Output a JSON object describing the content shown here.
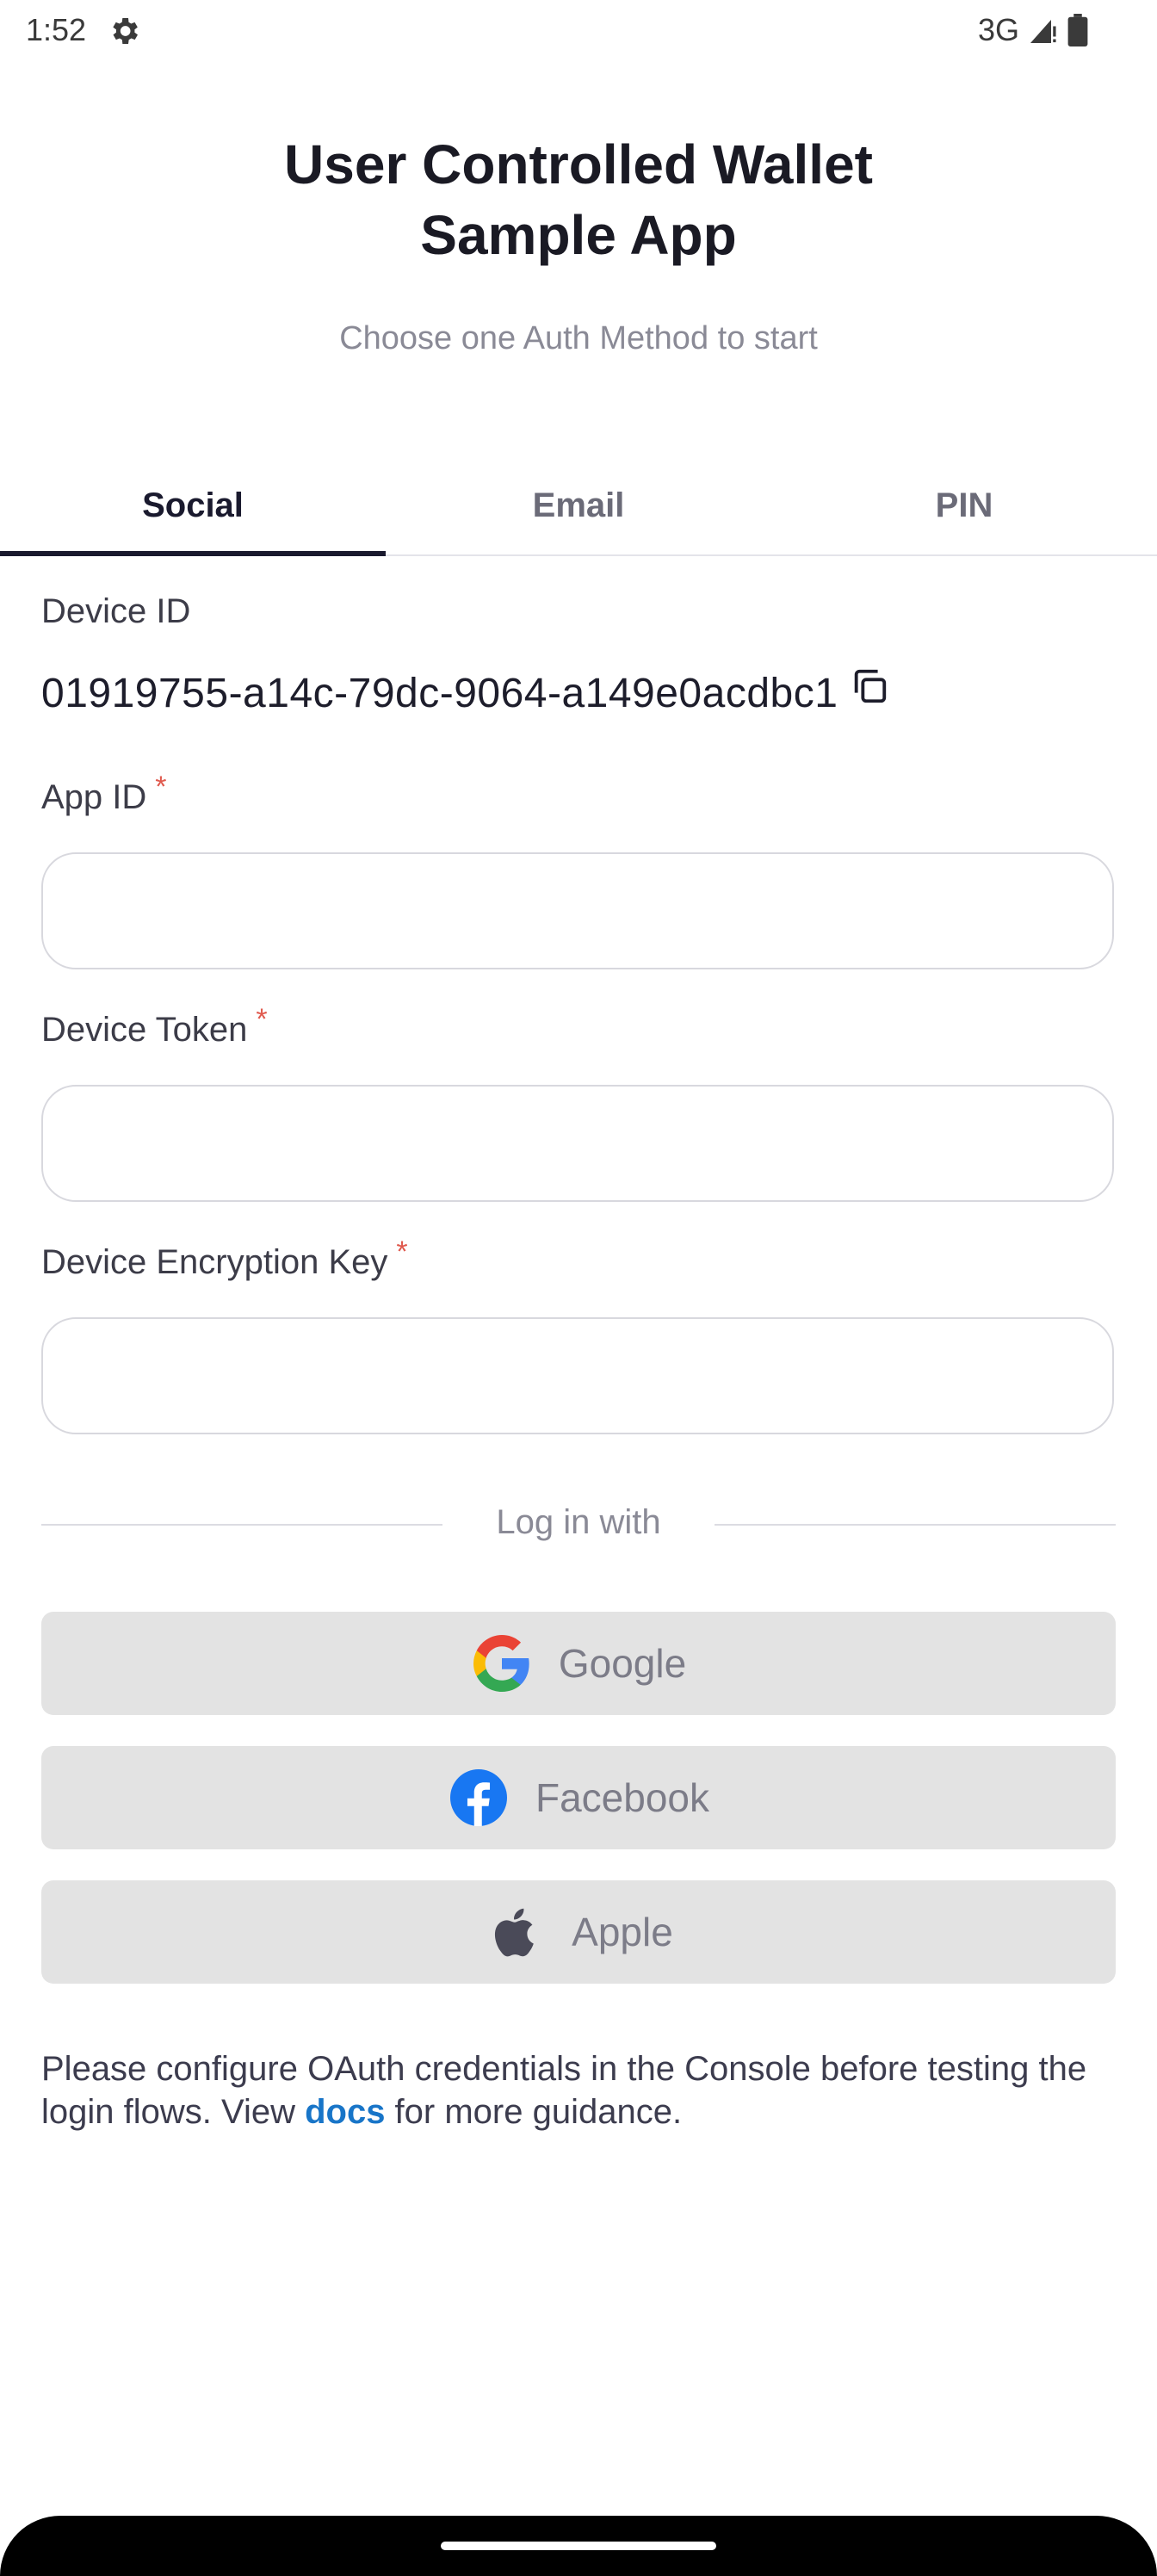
{
  "status_bar": {
    "time": "1:52",
    "network": "3G",
    "icons": [
      "gear-icon",
      "signal-icon",
      "battery-icon"
    ]
  },
  "header": {
    "title_line1": "User Controlled Wallet",
    "title_line2": "Sample App",
    "subtitle": "Choose one Auth Method to start"
  },
  "tabs": [
    {
      "label": "Social",
      "active": true
    },
    {
      "label": "Email",
      "active": false
    },
    {
      "label": "PIN",
      "active": false
    }
  ],
  "form": {
    "device_id": {
      "label": "Device ID",
      "value": "01919755-a14c-79dc-9064-a149e0acdbc1",
      "icon": "copy-icon"
    },
    "app_id": {
      "label": "App ID",
      "required_mark": "*",
      "value": ""
    },
    "device_token": {
      "label": "Device Token",
      "required_mark": "*",
      "value": ""
    },
    "device_encryption_key": {
      "label": "Device Encryption Key",
      "required_mark": "*",
      "value": ""
    }
  },
  "login": {
    "divider_text": "Log in with",
    "buttons": [
      {
        "label": "Google",
        "icon": "google-icon"
      },
      {
        "label": "Facebook",
        "icon": "facebook-icon"
      },
      {
        "label": "Apple",
        "icon": "apple-icon"
      }
    ]
  },
  "footer": {
    "text_before": "Please configure OAuth credentials in the Console before testing the login flows. View ",
    "link_text": "docs",
    "text_after": " for more guidance."
  },
  "colors": {
    "accent_tab": "#1a1a2e",
    "required": "#e05a4e",
    "link": "#1875c8",
    "button_bg": "#e3e3e3"
  }
}
